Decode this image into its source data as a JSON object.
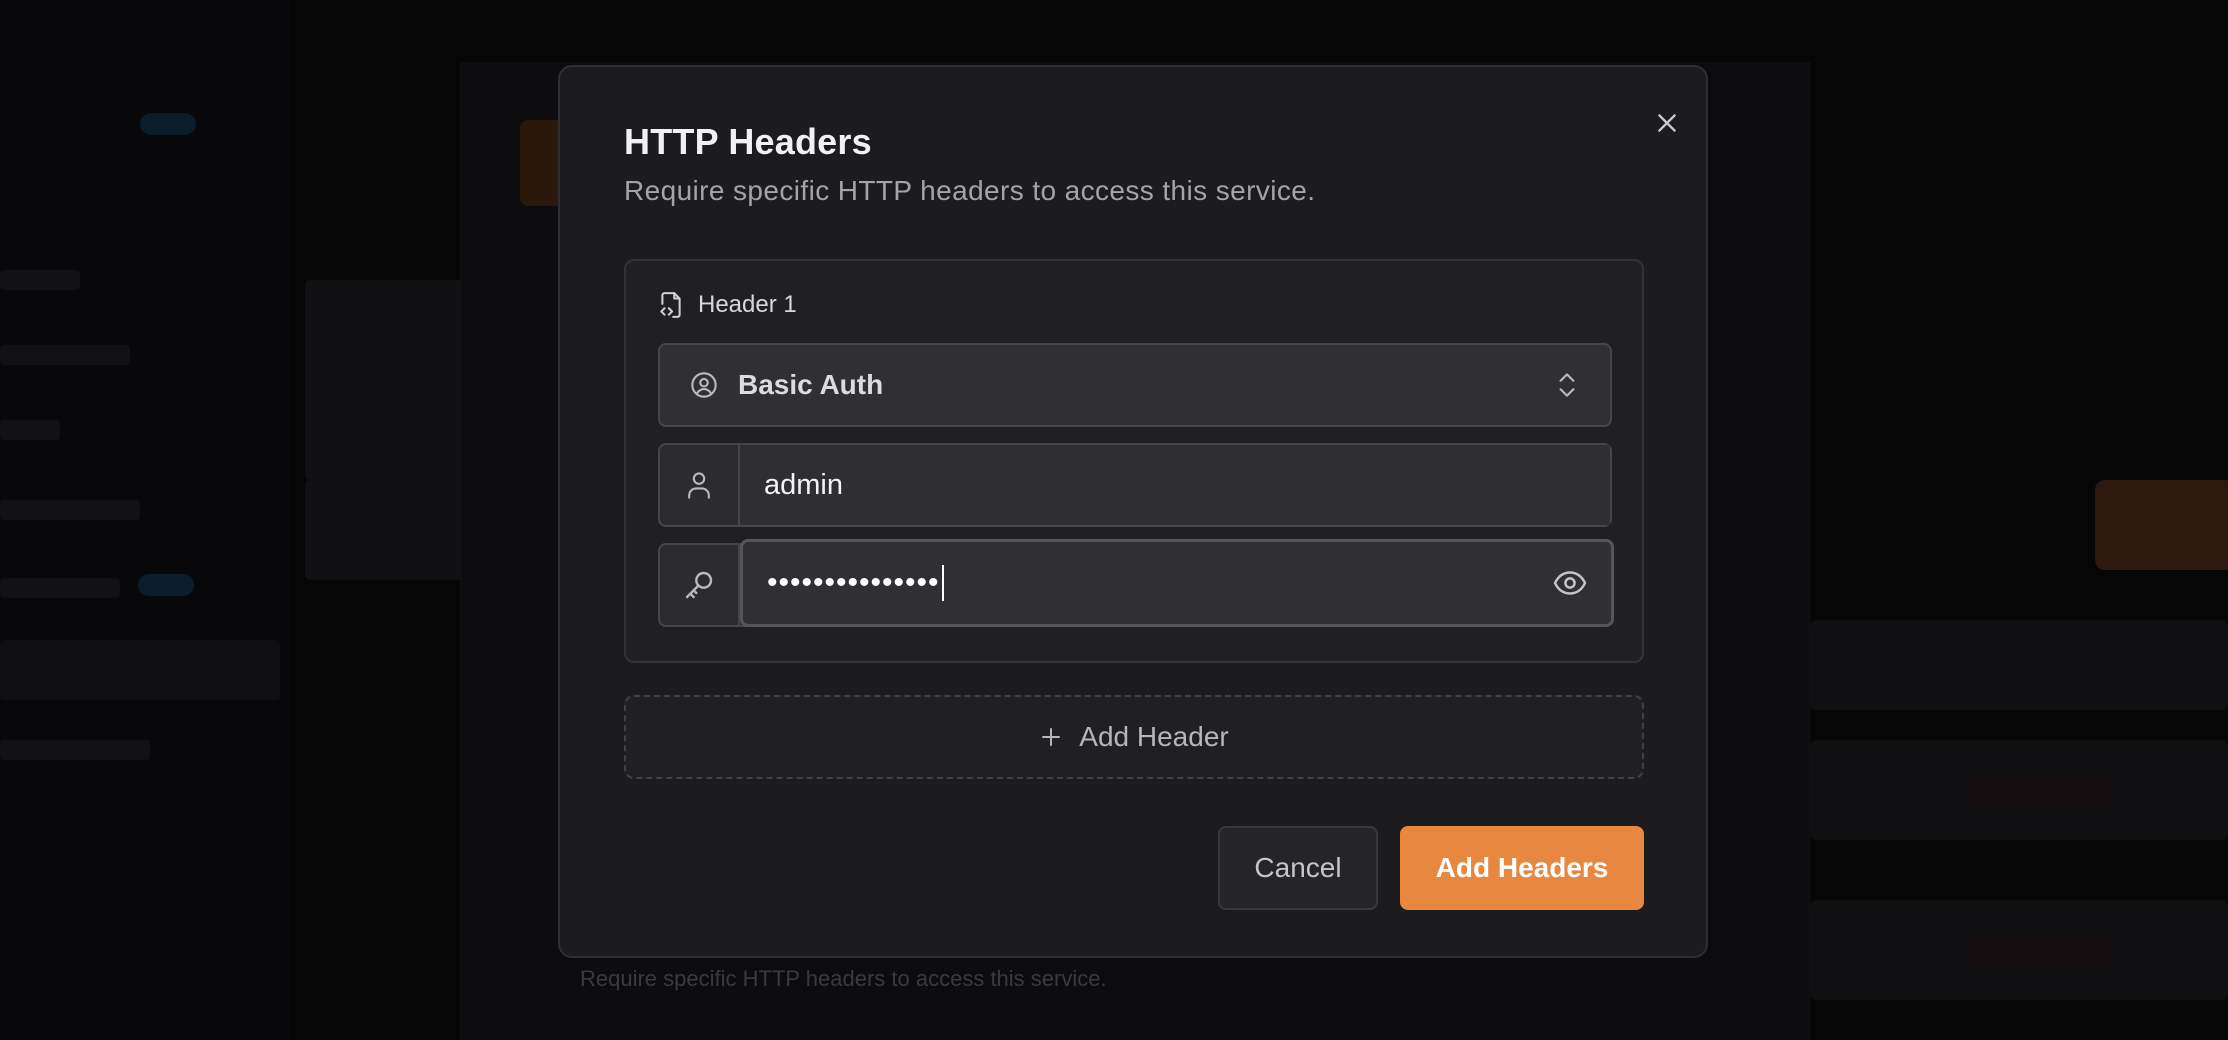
{
  "modal": {
    "title": "HTTP Headers",
    "subtitle": "Require specific HTTP headers to access this service.",
    "close_icon": "close-icon"
  },
  "header_card": {
    "title": "Header 1",
    "icon": "file-code-icon",
    "type_select": {
      "icon": "user-circle-icon",
      "value": "Basic Auth",
      "chevron_icon": "chevrons-up-down-icon"
    },
    "username": {
      "icon": "user-icon",
      "value": "admin"
    },
    "password": {
      "icon": "key-icon",
      "masked_value": "•••••••••••••••",
      "toggle_icon": "eye-icon"
    }
  },
  "add_header": {
    "icon": "plus-icon",
    "label": "Add Header"
  },
  "footer": {
    "cancel_label": "Cancel",
    "submit_label": "Add Headers"
  },
  "background": {
    "under_text": "Require specific HTTP headers to access this service."
  },
  "colors": {
    "accent": "#e8873f",
    "modal_bg": "#1c1c1f",
    "overlay_bg": "#060607"
  }
}
